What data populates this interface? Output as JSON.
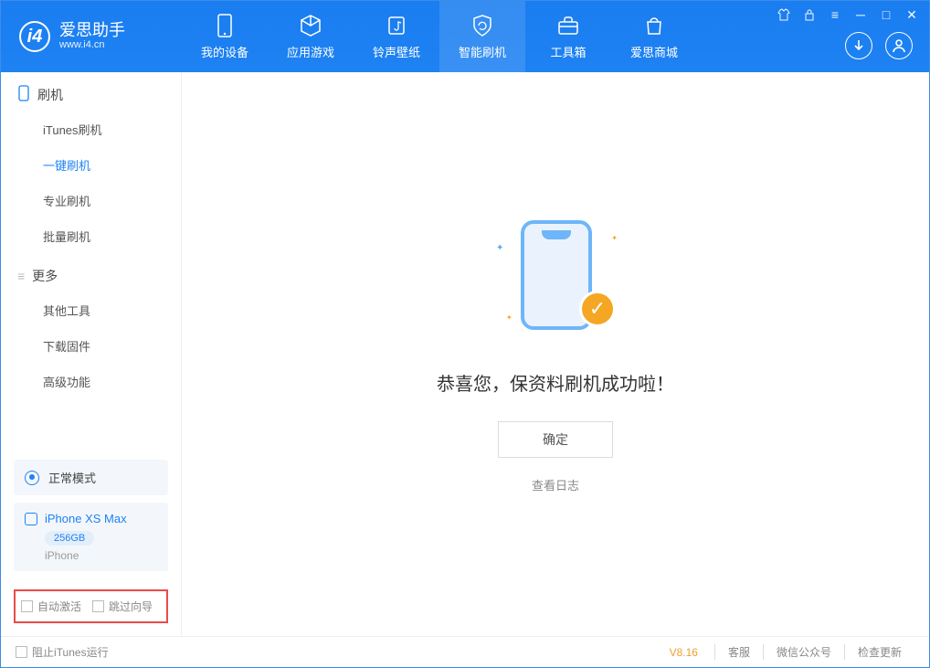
{
  "app": {
    "name_cn": "爱思助手",
    "name_en": "www.i4.cn"
  },
  "nav": {
    "tabs": [
      {
        "label": "我的设备"
      },
      {
        "label": "应用游戏"
      },
      {
        "label": "铃声壁纸"
      },
      {
        "label": "智能刷机"
      },
      {
        "label": "工具箱"
      },
      {
        "label": "爱思商城"
      }
    ]
  },
  "sidebar": {
    "section1_title": "刷机",
    "section1_items": [
      {
        "label": "iTunes刷机"
      },
      {
        "label": "一键刷机"
      },
      {
        "label": "专业刷机"
      },
      {
        "label": "批量刷机"
      }
    ],
    "section2_title": "更多",
    "section2_items": [
      {
        "label": "其他工具"
      },
      {
        "label": "下载固件"
      },
      {
        "label": "高级功能"
      }
    ],
    "mode_label": "正常模式",
    "device": {
      "name": "iPhone XS Max",
      "storage": "256GB",
      "type": "iPhone"
    },
    "cb_auto_activate": "自动激活",
    "cb_skip_guide": "跳过向导"
  },
  "main": {
    "success_title": "恭喜您，保资料刷机成功啦！",
    "ok_button": "确定",
    "log_link": "查看日志"
  },
  "statusbar": {
    "prevent_itunes": "阻止iTunes运行",
    "version": "V8.16",
    "support": "客服",
    "wechat": "微信公众号",
    "check_update": "检查更新"
  }
}
